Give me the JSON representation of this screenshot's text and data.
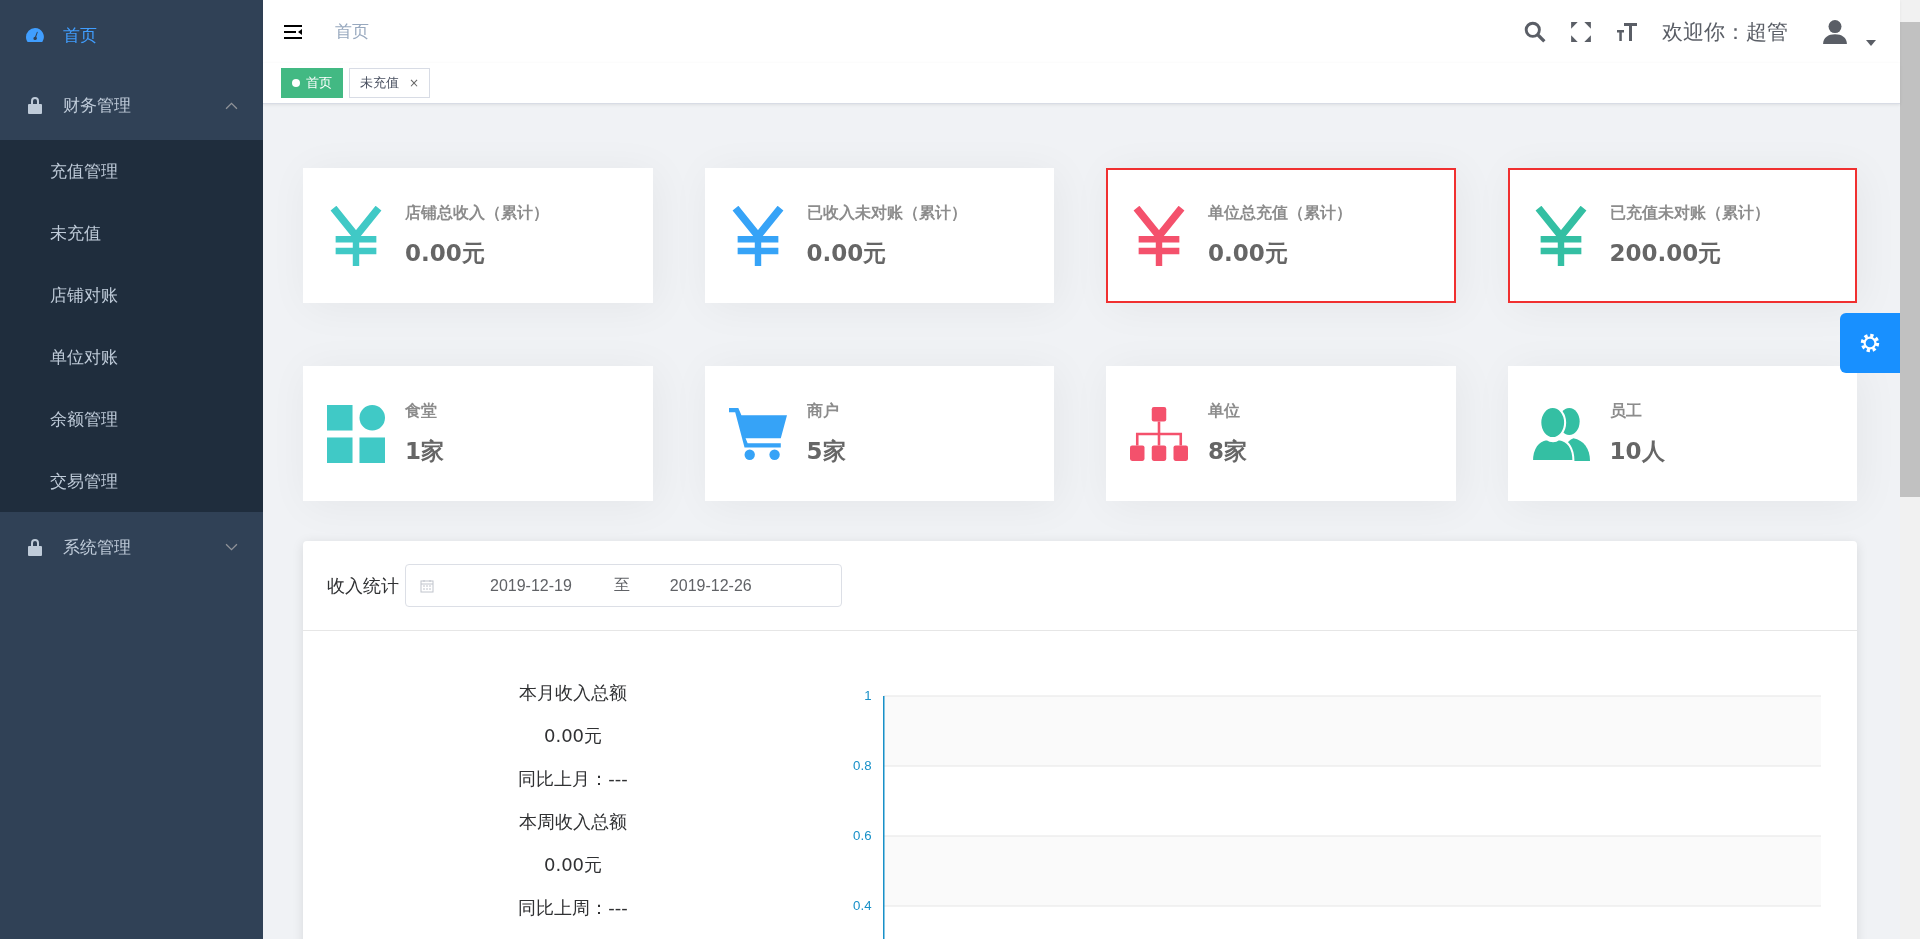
{
  "sidebar": {
    "items": [
      {
        "label": "首页",
        "kind": "page",
        "selected": true
      },
      {
        "label": "财务管理",
        "kind": "group",
        "expanded": true,
        "children": [
          {
            "label": "充值管理",
            "selected": false
          },
          {
            "label": "未充值",
            "selected": false
          },
          {
            "label": "店铺对账",
            "selected": false
          },
          {
            "label": "单位对账",
            "selected": false
          },
          {
            "label": "余额管理",
            "selected": false
          },
          {
            "label": "交易管理",
            "selected": false
          }
        ]
      },
      {
        "label": "系统管理",
        "kind": "group",
        "expanded": false
      }
    ]
  },
  "header": {
    "breadcrumb": "首页",
    "welcome": "欢迎你：超管"
  },
  "tags": [
    {
      "label": "首页",
      "selected": true,
      "closable": false
    },
    {
      "label": "未充值",
      "selected": false,
      "closable": true,
      "close": "×"
    }
  ],
  "stat_cards": [
    {
      "label": "店铺总收入（累计）",
      "value": "0.00元",
      "kind": "yen",
      "color": "#40c9c6",
      "highlighted": false
    },
    {
      "label": "已收入未对账（累计）",
      "value": "0.00元",
      "kind": "yen",
      "color": "#36a3f7",
      "highlighted": false
    },
    {
      "label": "单位总充值（累计）",
      "value": "0.00元",
      "kind": "yen",
      "color": "#f4516c",
      "highlighted": true
    },
    {
      "label": "已充值未对账（累计）",
      "value": "200.00元",
      "kind": "yen",
      "color": "#34bfa3",
      "highlighted": true
    },
    {
      "label": "食堂",
      "value": "1家",
      "kind": "blocks",
      "color": "#40c9c6",
      "highlighted": false
    },
    {
      "label": "商户",
      "value": "5家",
      "kind": "cart",
      "color": "#36a3f7",
      "highlighted": false
    },
    {
      "label": "单位",
      "value": "8家",
      "kind": "org",
      "color": "#f4516c",
      "highlighted": false
    },
    {
      "label": "员工",
      "value": "10人",
      "kind": "users",
      "color": "#34bfa3",
      "highlighted": false
    }
  ],
  "income": {
    "title": "收入统计",
    "date_range": {
      "start": "2019-12-19",
      "separator": "至",
      "end": "2019-12-26"
    },
    "summary": [
      "本月收入总额",
      "0.00元",
      "同比上月：---",
      "本周收入总额",
      "0.00元",
      "同比上周：---"
    ],
    "y_axis_labels": [
      "1",
      "0.8",
      "0.6",
      "0.4"
    ]
  }
}
